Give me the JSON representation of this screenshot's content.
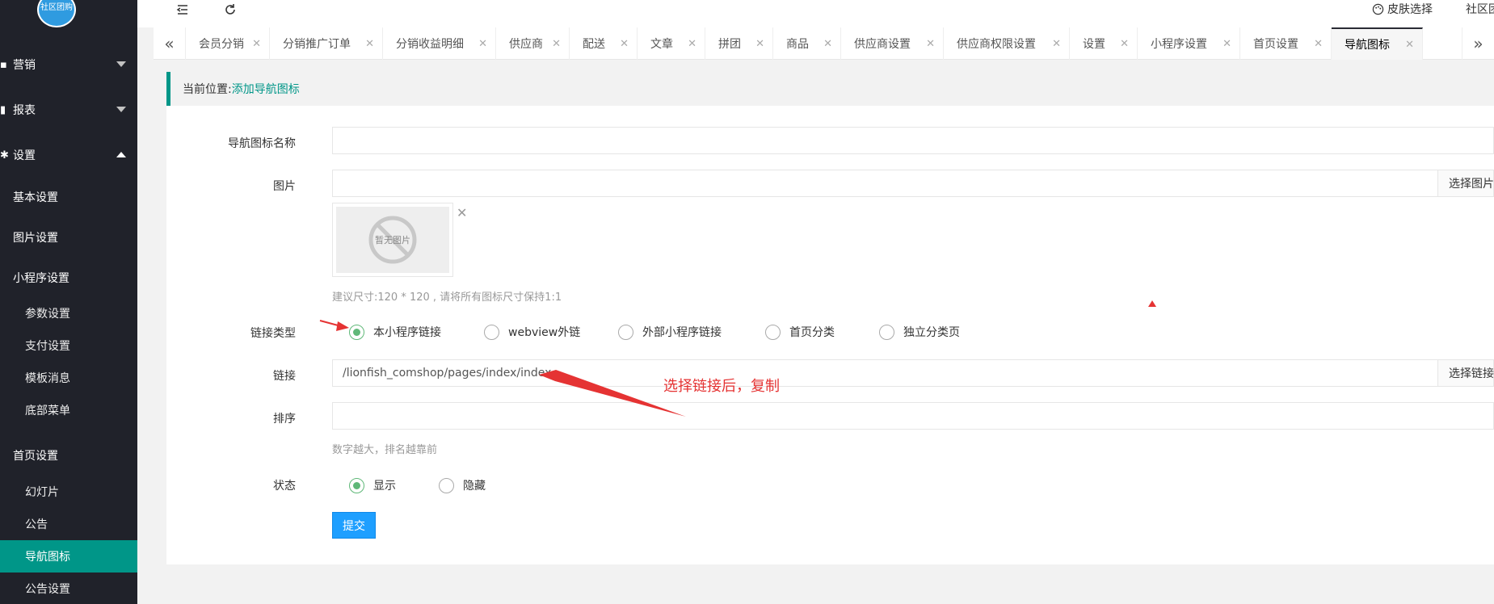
{
  "logo": {
    "text": "社区团购"
  },
  "header": {
    "skin_label": "皮肤选择",
    "user_label": "社区团"
  },
  "sidebar": {
    "top_menus": [
      {
        "label": "营销",
        "icon": "marketing-icon",
        "expanded": false
      },
      {
        "label": "报表",
        "icon": "report-icon",
        "expanded": false
      },
      {
        "label": "设置",
        "icon": "gear-icon",
        "expanded": true
      }
    ],
    "items": [
      {
        "label": "基本设置"
      },
      {
        "label": "图片设置"
      },
      {
        "label": "小程序设置"
      },
      {
        "label": "参数设置"
      },
      {
        "label": "支付设置"
      },
      {
        "label": "模板消息"
      },
      {
        "label": "底部菜单"
      },
      {
        "label": "首页设置"
      },
      {
        "label": "幻灯片"
      },
      {
        "label": "公告"
      },
      {
        "label": "导航图标"
      },
      {
        "label": "公告设置"
      }
    ]
  },
  "tabs": [
    {
      "label": "会员分销"
    },
    {
      "label": "分销推广订单"
    },
    {
      "label": "分销收益明细"
    },
    {
      "label": "供应商"
    },
    {
      "label": "配送"
    },
    {
      "label": "文章"
    },
    {
      "label": "拼团"
    },
    {
      "label": "商品"
    },
    {
      "label": "供应商设置"
    },
    {
      "label": "供应商权限设置"
    },
    {
      "label": "设置"
    },
    {
      "label": "小程序设置"
    },
    {
      "label": "首页设置"
    },
    {
      "label": "导航图标",
      "active": true
    }
  ],
  "breadcrumb": {
    "prefix": "当前位置:",
    "current": "添加导航图标"
  },
  "form": {
    "name_label": "导航图标名称",
    "name_value": "",
    "image_label": "图片",
    "image_value": "",
    "image_button": "选择图片",
    "image_placeholder": "暂无图片",
    "image_hint": "建议尺寸:120 * 120 , 请将所有图标尺寸保持1:1",
    "link_type_label": "链接类型",
    "link_types": [
      {
        "label": "本小程序链接",
        "checked": true
      },
      {
        "label": "webview外链",
        "checked": false
      },
      {
        "label": "外部小程序链接",
        "checked": false
      },
      {
        "label": "首页分类",
        "checked": false
      },
      {
        "label": "独立分类页",
        "checked": false
      }
    ],
    "link_label": "链接",
    "link_value": "/lionfish_comshop/pages/index/index",
    "link_button": "选择链接",
    "sort_label": "排序",
    "sort_value": "",
    "sort_hint": "数字越大，排名越靠前",
    "status_label": "状态",
    "status_options": [
      {
        "label": "显示",
        "checked": true
      },
      {
        "label": "隐藏",
        "checked": false
      }
    ],
    "submit_label": "提交"
  },
  "annotation": {
    "text": "选择链接后，复制"
  },
  "colors": {
    "accent": "#009688",
    "sidebar_bg": "#20222a",
    "primary_button": "#1e9fff",
    "radio_checked": "#5fb878",
    "annotation_red": "#e53333"
  }
}
